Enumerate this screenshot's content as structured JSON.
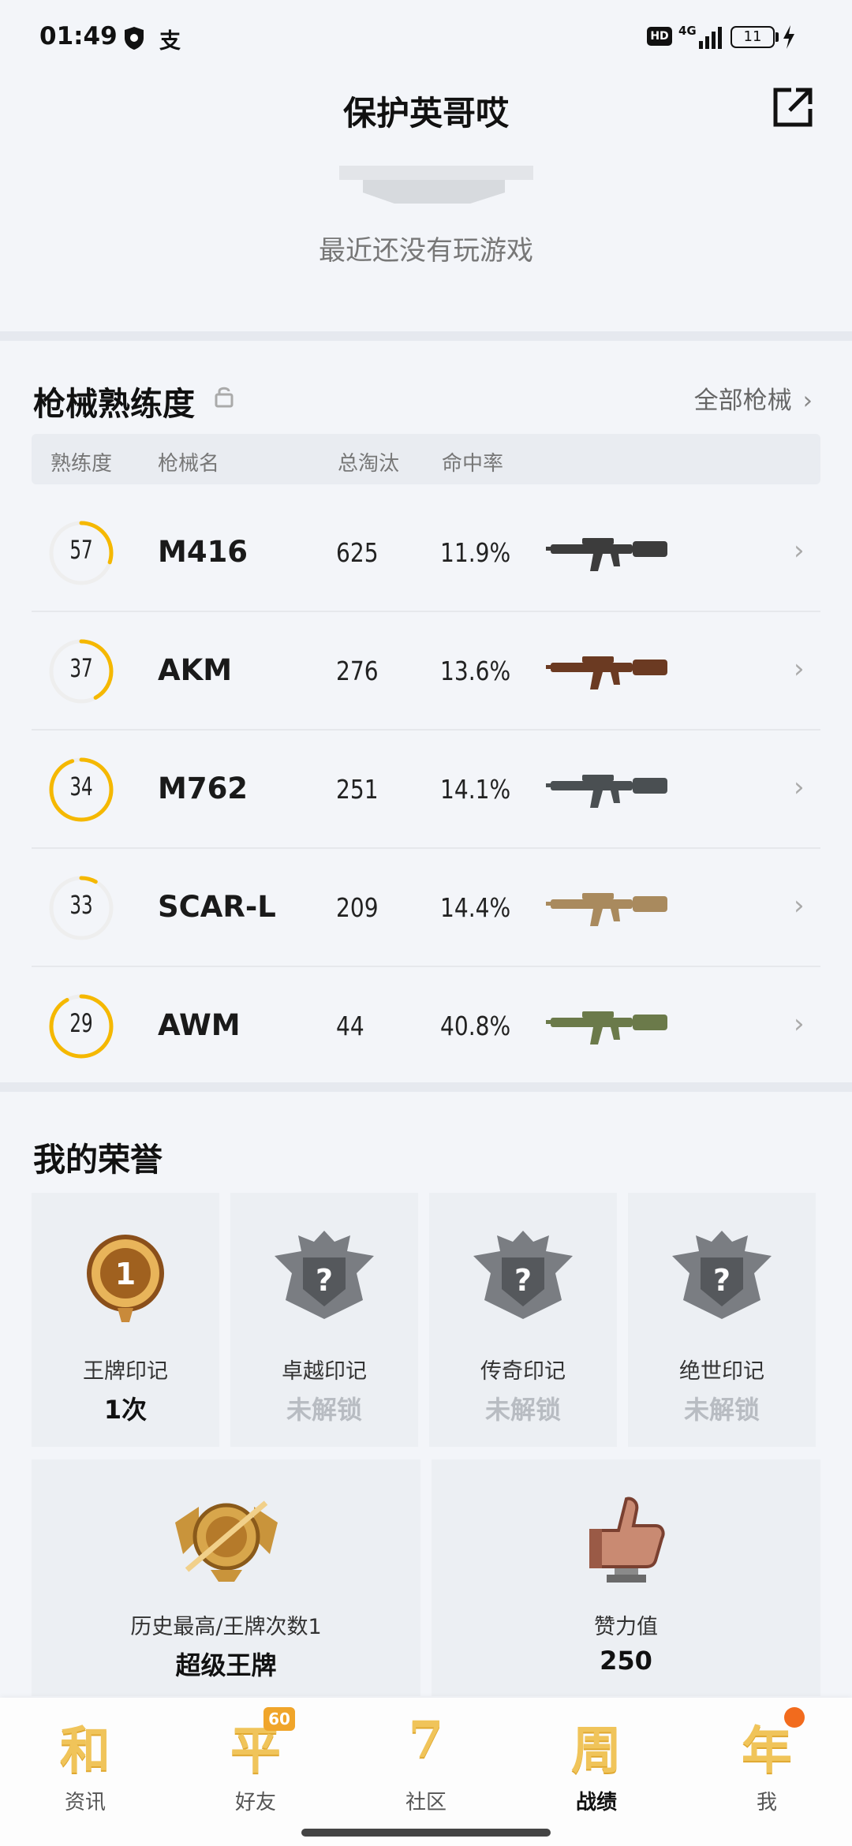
{
  "status_bar": {
    "time": "01:49",
    "alipay_glyph": "支",
    "hd": "HD",
    "network": "4G",
    "battery": "11",
    "icons": [
      "shield-icon",
      "signal-icon",
      "charge-icon"
    ]
  },
  "header": {
    "title": "保护英哥哎",
    "share_icon": "share-external-icon"
  },
  "recent": {
    "empty_text": "最近还没有玩游戏"
  },
  "weapons": {
    "title": "枪械熟练度",
    "all_link": "全部枪械",
    "chevron": "›",
    "columns": [
      "熟练度",
      "枪械名",
      "总淘汰",
      "命中率"
    ],
    "rows": [
      {
        "mastery": "57",
        "progress": 0.3,
        "name": "M416",
        "kills": "625",
        "rate": "11.9%",
        "gun_color": "#3c3c3c"
      },
      {
        "mastery": "37",
        "progress": 0.42,
        "name": "AKM",
        "kills": "276",
        "rate": "13.6%",
        "gun_color": "#6b3a22"
      },
      {
        "mastery": "34",
        "progress": 0.95,
        "name": "M762",
        "kills": "251",
        "rate": "14.1%",
        "gun_color": "#4a4f52"
      },
      {
        "mastery": "33",
        "progress": 0.08,
        "name": "SCAR-L",
        "kills": "209",
        "rate": "14.4%",
        "gun_color": "#a98a5e"
      },
      {
        "mastery": "29",
        "progress": 0.92,
        "name": "AWM",
        "kills": "44",
        "rate": "40.8%",
        "gun_color": "#6b7a4a"
      }
    ]
  },
  "honors": {
    "title": "我的荣誉",
    "cards": [
      {
        "label": "王牌印记",
        "value": "1次",
        "locked": false,
        "badge_digit": "1"
      },
      {
        "label": "卓越印记",
        "value": "未解锁",
        "locked": true,
        "badge_digit": "?"
      },
      {
        "label": "传奇印记",
        "value": "未解锁",
        "locked": true,
        "badge_digit": "?"
      },
      {
        "label": "绝世印记",
        "value": "未解锁",
        "locked": true,
        "badge_digit": "?"
      }
    ],
    "big_cards": [
      {
        "label": "历史最高/王牌次数1",
        "value": "超级王牌"
      },
      {
        "label": "赞力值",
        "value": "250"
      }
    ]
  },
  "bottom_nav": {
    "items": [
      {
        "glyph": "和",
        "label": "资讯",
        "active": false
      },
      {
        "glyph": "平",
        "label": "好友",
        "active": false,
        "badge": "60"
      },
      {
        "glyph": "7",
        "label": "社区",
        "active": false
      },
      {
        "glyph": "周",
        "label": "战绩",
        "active": true
      },
      {
        "glyph": "年",
        "label": "我",
        "active": false
      }
    ]
  },
  "colors": {
    "accent": "#f5b800",
    "ring_track": "#eeeeee",
    "background": "#f3f5f9"
  }
}
